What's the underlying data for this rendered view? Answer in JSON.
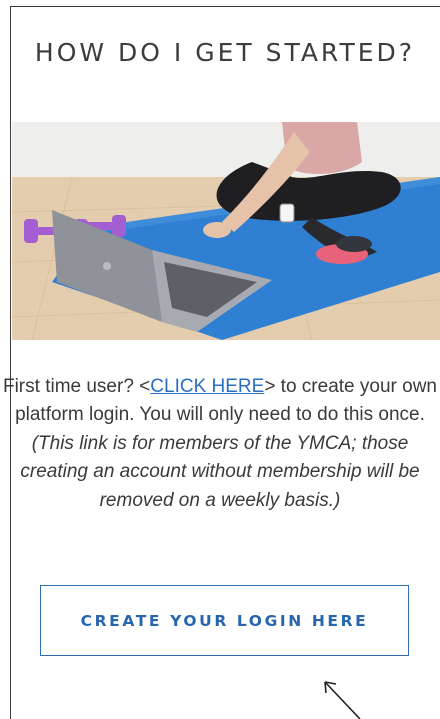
{
  "section": {
    "title": "HOW DO I GET STARTED?"
  },
  "hero": {
    "image_alt": "Person sitting on a blue yoga mat using a laptop next to purple dumbbells",
    "colors": {
      "mat": "#2f7fd4",
      "dumbbell": "#a15fd0",
      "floor": "#e2c9a8",
      "wall": "#ededeb"
    }
  },
  "intro": {
    "prefix": "First time user?  <",
    "link_label": "CLICK HERE",
    "suffix": "> to create your own platform login. You will only need to do this once. ",
    "note": "(This link is for members of the YMCA;  those creating an account without membership will be removed on a weekly basis.)"
  },
  "cta": {
    "label": "CREATE YOUR LOGIN HERE",
    "accent_color": "#2f6bb6"
  },
  "pointer": {
    "icon": "arrow-pointer-icon"
  }
}
